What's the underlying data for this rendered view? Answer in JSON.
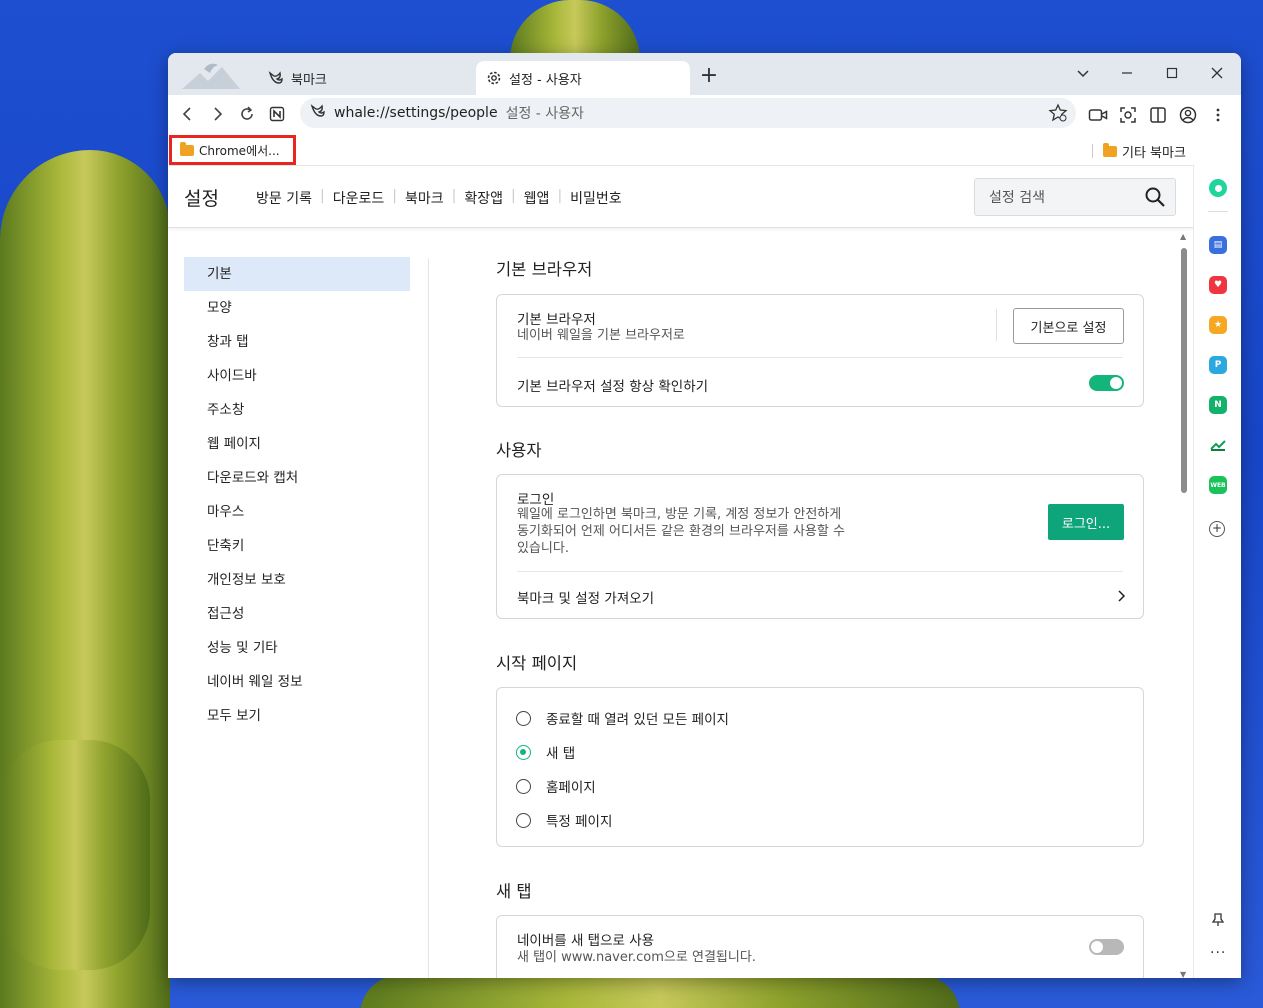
{
  "browser": {
    "tabs": [
      {
        "title": "북마크",
        "icon": "whale-icon"
      },
      {
        "title": "설정 - 사용자",
        "icon": "gear-icon"
      }
    ],
    "omnibox": {
      "url": "whale://settings/people",
      "page_title": "설정 - 사용자"
    },
    "bookmarks": {
      "left_folder": "Chrome에서...",
      "right_folder": "기타 북마크"
    }
  },
  "settings": {
    "title": "설정",
    "header_links": [
      "방문 기록",
      "다운로드",
      "북마크",
      "확장앱",
      "웹앱",
      "비밀번호"
    ],
    "search_placeholder": "설정 검색",
    "sidebar": [
      {
        "label": "기본",
        "active": true
      },
      {
        "label": "모양"
      },
      {
        "label": "창과 탭"
      },
      {
        "label": "사이드바"
      },
      {
        "label": "주소창"
      },
      {
        "label": "웹 페이지"
      },
      {
        "label": "다운로드와 캡처"
      },
      {
        "label": "마우스"
      },
      {
        "label": "단축키"
      },
      {
        "label": "개인정보 보호"
      },
      {
        "label": "접근성"
      },
      {
        "label": "성능 및 기타"
      },
      {
        "label": "네이버 웨일 정보"
      },
      {
        "label": "모두 보기"
      }
    ],
    "default_browser": {
      "section_title": "기본 브라우저",
      "row_title": "기본 브라우저",
      "row_desc": "네이버 웨일을 기본 브라우저로",
      "button": "기본으로 설정",
      "check_label": "기본 브라우저 설정 항상 확인하기",
      "check_on": true
    },
    "user": {
      "section_title": "사용자",
      "login_title": "로그인",
      "login_desc_1": "웨일에 로그인하면 북마크, 방문 기록, 계정 정보가 안전하게",
      "login_desc_2": "동기화되어 언제 어디서든 같은 환경의 브라우저를 사용할 수",
      "login_desc_3": "있습니다.",
      "login_button": "로그인...",
      "import_label": "북마크 및 설정 가져오기"
    },
    "start_page": {
      "section_title": "시작 페이지",
      "options": [
        "종료할 때 열려 있던 모든 페이지",
        "새 탭",
        "홈페이지",
        "특정 페이지"
      ],
      "selected": "새 탭"
    },
    "new_tab": {
      "section_title": "새 탭",
      "row_title": "네이버를 새 탭으로 사용",
      "row_desc": "새 탭이 www.naver.com으로 연결됩니다.",
      "toggle_on": false
    }
  },
  "colors": {
    "accent": "#13b57a",
    "button_green": "#0fa57a",
    "highlight": "#dde9f8",
    "bookmark_outline": "#e8261f"
  }
}
